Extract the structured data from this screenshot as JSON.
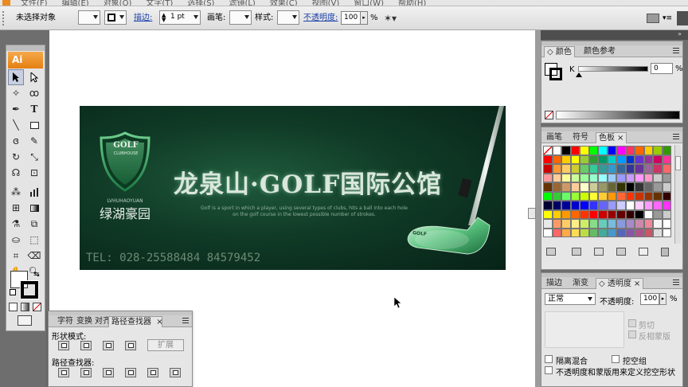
{
  "menubar": {
    "items": [
      "文件(F)",
      "编辑(E)",
      "对象(O)",
      "文字(T)",
      "选择(S)",
      "滤镜(L)",
      "效果(C)",
      "视图(V)",
      "窗口(W)",
      "帮助(H)"
    ]
  },
  "controlbar": {
    "selection_status": "未选择对象",
    "stroke_label": "描边:",
    "stroke_weight": "1 pt",
    "brush_label": "画笔:",
    "style_label": "样式:",
    "opacity_label": "不透明度:",
    "opacity_value": "100",
    "opacity_unit": "%"
  },
  "toolbar": {
    "logo": "Ai"
  },
  "artwork": {
    "slogan": "龙泉山·GOLF国际公馆",
    "shield_text": "GOLF",
    "shield_subtext": "CLUBHOUSE",
    "small_line1": "Golf is a sport in which a player, using several types of clubs, hits a ball into each hole",
    "small_line2": "on the golf course in the lowest possible number of strokes.",
    "pinyin": "LVHUHAOYUAN",
    "brand": "绿湖豪园",
    "tel": "TEL: 028-25588484 84579452",
    "club_text": "GOLF"
  },
  "pathfinder_panel": {
    "tabs": [
      "字符",
      "变换",
      "对齐",
      "路径查找器"
    ],
    "close": "×",
    "shape_modes_label": "形状模式:",
    "expand_button": "扩展",
    "pathfinders_label": "路径查找器:"
  },
  "color_panel": {
    "tabs": [
      "颜色",
      "颜色参考"
    ],
    "channel": "K",
    "value": "0",
    "unit": "%"
  },
  "swatch_panel": {
    "tabs": [
      "画笔",
      "符号",
      "色板"
    ],
    "close": "×",
    "colors": [
      "#ffffff",
      "#ffffff",
      "#000000",
      "#ff0000",
      "#ffff00",
      "#00ff00",
      "#00ffff",
      "#0000ff",
      "#ff00ff",
      "#ff3366",
      "#ff6600",
      "#ffcc00",
      "#99cc00",
      "#339900",
      "#ff0000",
      "#ff6600",
      "#ffcc00",
      "#ffff00",
      "#99cc33",
      "#339933",
      "#009966",
      "#00cccc",
      "#0099ff",
      "#0033cc",
      "#6633cc",
      "#993399",
      "#cc0066",
      "#ff3399",
      "#cc0000",
      "#ff9933",
      "#ffcc66",
      "#cccc33",
      "#66cc66",
      "#33cc99",
      "#339999",
      "#3399cc",
      "#336699",
      "#333399",
      "#663399",
      "#996699",
      "#cc3366",
      "#ff6666",
      "#ff9999",
      "#ffcc99",
      "#ffff99",
      "#ccff99",
      "#99ff99",
      "#99ffcc",
      "#99ffff",
      "#99ccff",
      "#9999ff",
      "#cc99ff",
      "#ff99ff",
      "#ff99cc",
      "#cccccc",
      "#999999",
      "#663300",
      "#996633",
      "#cc9966",
      "#ffcc99",
      "#ffffcc",
      "#cccc99",
      "#999966",
      "#666633",
      "#333300",
      "#000000",
      "#333333",
      "#666666",
      "#999999",
      "#cccccc",
      "#00ff00",
      "#33cc33",
      "#66ff66",
      "#99ff33",
      "#ccff00",
      "#ffff33",
      "#ffcc33",
      "#ff9900",
      "#ff6633",
      "#ff3300",
      "#cc3300",
      "#993300",
      "#663300",
      "#330000",
      "#000033",
      "#000066",
      "#000099",
      "#0000cc",
      "#0000ff",
      "#3333ff",
      "#6666ff",
      "#9999ff",
      "#ccccff",
      "#ffffff",
      "#ffccff",
      "#ff99ff",
      "#ff66ff",
      "#ff33ff",
      "#ffff00",
      "#ffcc00",
      "#ff9900",
      "#ff6600",
      "#ff3300",
      "#ff0000",
      "#cc0000",
      "#990000",
      "#660000",
      "#330000",
      "#000000",
      "#ffffff",
      "#999999",
      "#cccccc",
      "#e8e8e8",
      "#ff9966",
      "#ffcc66",
      "#ffee88",
      "#ccee66",
      "#88dd88",
      "#66ccbb",
      "#77bbdd",
      "#8899dd",
      "#aa88cc",
      "#cc88aa",
      "#ee8899",
      "#f4f4f4",
      "#ffffff",
      "#ffffff",
      "#ff6666",
      "#ffaa44",
      "#ffdd55",
      "#bbdd44",
      "#66bb66",
      "#44aa99",
      "#4499cc",
      "#5566bb",
      "#8855aa",
      "#aa5588",
      "#cc5566",
      "#dddddd",
      "#ffffff"
    ]
  },
  "transparency_panel": {
    "tabs": [
      "描边",
      "渐变",
      "透明度"
    ],
    "close": "×",
    "blend_mode": "正常",
    "opacity_label": "不透明度:",
    "opacity_value": "100",
    "unit": "%",
    "clip_label": "剪切",
    "invert_mask_label": "反相蒙版",
    "isolate_blending_label": "隔离混合",
    "knockout_group_label": "挖空组",
    "opacity_mask_define_label": "不透明度和蒙版用来定义挖空形状"
  }
}
